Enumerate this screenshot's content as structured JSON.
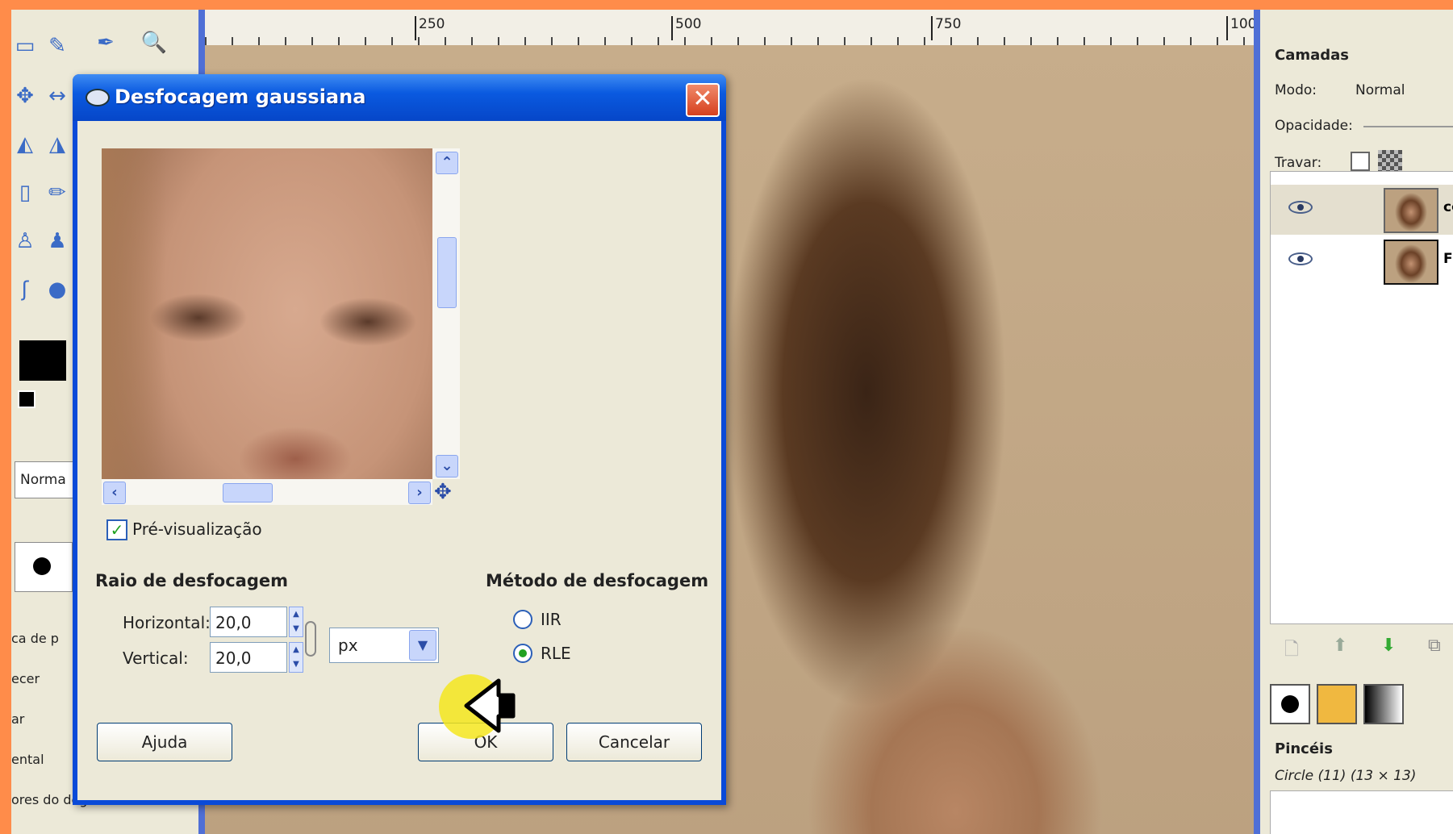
{
  "ruler": {
    "marks": [
      "250",
      "500",
      "750",
      "100"
    ]
  },
  "toolbox": {
    "mode_value": "Norma",
    "texts": [
      "ca de p",
      "ecer",
      "ar",
      "ental",
      "ores do degradé"
    ]
  },
  "dialog": {
    "title": "Desfocagem gaussiana",
    "preview_checkbox_label": "Pré-visualização",
    "radius_section": "Raio de desfocagem",
    "horizontal_label": "Horizontal:",
    "horizontal_value": "20,0",
    "vertical_label": "Vertical:",
    "vertical_value": "20,0",
    "unit": "px",
    "method_section": "Método de desfocagem",
    "method_options": [
      "IIR",
      "RLE"
    ],
    "selected_method": "RLE",
    "help_button": "Ajuda",
    "ok_button": "OK",
    "cancel_button": "Cancelar"
  },
  "dock": {
    "layers_title": "Camadas",
    "mode_label": "Modo:",
    "mode_value": "Normal",
    "opacity_label": "Opacidade:",
    "lock_label": "Travar:",
    "layers": [
      {
        "name": "có"
      },
      {
        "name": "Fu"
      }
    ],
    "brushes_title": "Pincéis",
    "brush_name": "Circle (11) (13 × 13)"
  }
}
